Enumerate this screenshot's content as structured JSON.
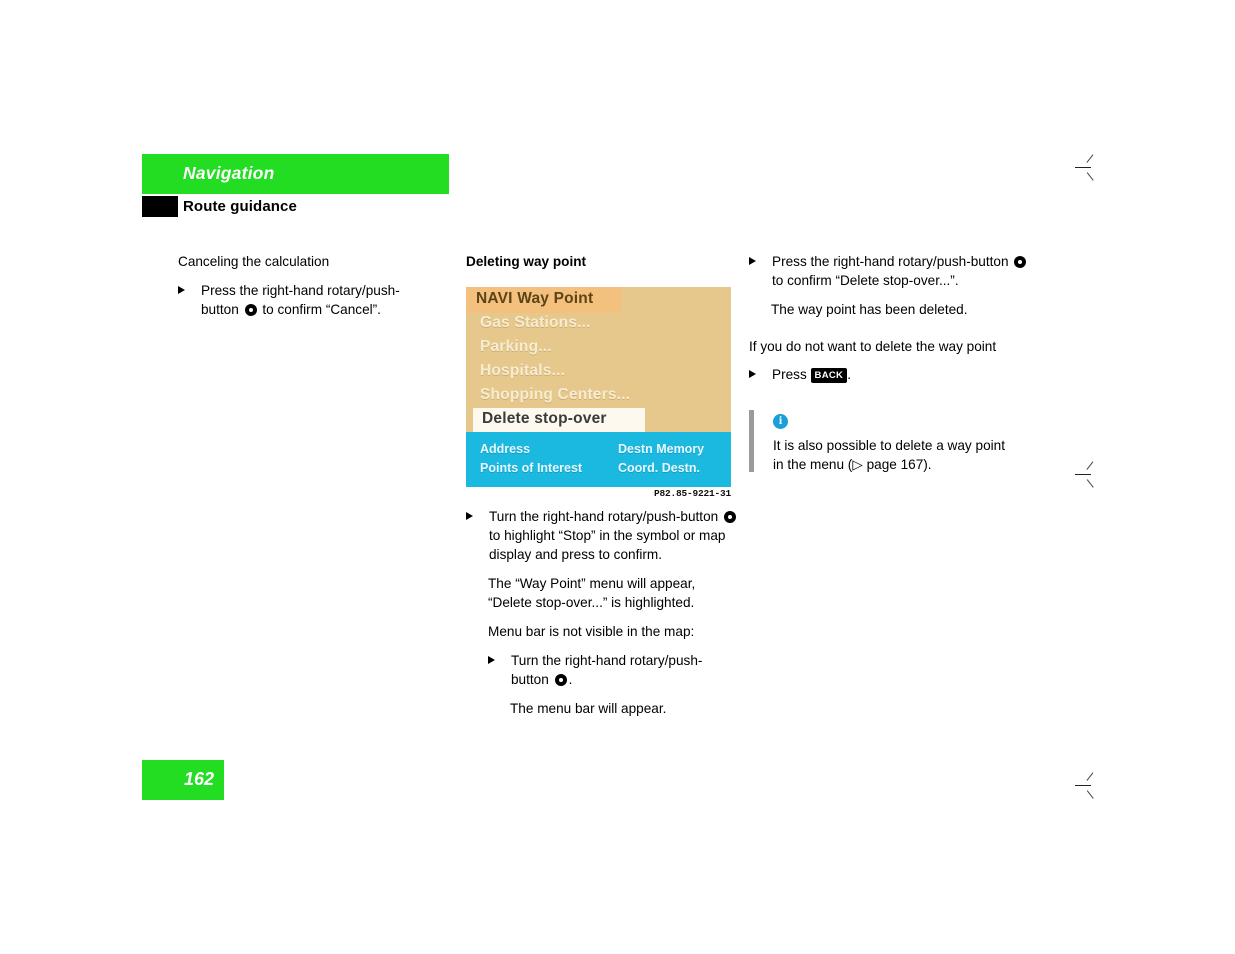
{
  "header": {
    "title": "Navigation",
    "subtitle": "Route guidance",
    "band_color": "#22dd22",
    "tab_color": "#000000"
  },
  "left_column": {
    "subhead": "Canceling the calculation",
    "step_part1": "Press the right-hand rotary/push-button",
    "step_part2": "to confirm “Cancel”."
  },
  "middle_column": {
    "subhead": "Deleting way point",
    "figure": {
      "screen_title": "NAVI Way Point",
      "menu_items": [
        "Gas Stations...",
        "Parking...",
        "Hospitals...",
        "Shopping Centers..."
      ],
      "highlighted_item": "Delete stop-over",
      "menu_bar": [
        "Address",
        "Destn Memory",
        "Points of Interest",
        "Coord. Destn."
      ],
      "caption": "P82.85-9221-31",
      "colors": {
        "screen_bg": "#e6c88c",
        "title_bg": "#f3c07e",
        "title_text": "#5c4416",
        "item_text": "#f6ecd2",
        "highlight_bg": "#fdf9ef",
        "highlight_text": "#3a3a3a",
        "menu_bar_bg": "#1bb8e0",
        "menu_bar_text": "#e8f8ff"
      }
    },
    "step1_part1": "Turn the right-hand rotary/push-button",
    "step1_part2": "to highlight “Stop” in the symbol or map display and press to confirm.",
    "result1": "The “Way Point” menu will appear, “Delete stop-over...” is highlighted.",
    "subhead2": "Menu bar is not visible in the map:",
    "step2_part1": "Turn the right-hand rotary/push-button",
    "step2_part2": ".",
    "result2": "The menu bar will appear."
  },
  "right_column": {
    "step1_part1": "Press the right-hand rotary/push-button",
    "step1_part2": "to confirm “Delete stop-over...”.",
    "result1": "The way point has been deleted.",
    "subhead": "If you do not want to delete the way point",
    "step2_prefix": "Press",
    "step2_key": "BACK",
    "step2_suffix": ".",
    "note": {
      "icon": "info-icon",
      "text_line1": "It is also possible to delete a way point",
      "text_line2": "in the menu (▷ page 167).",
      "icon_color": "#1b9fd8",
      "bar_color": "#9a9a9a"
    }
  },
  "footer": {
    "page_number": "162",
    "box_color": "#22dd22"
  }
}
